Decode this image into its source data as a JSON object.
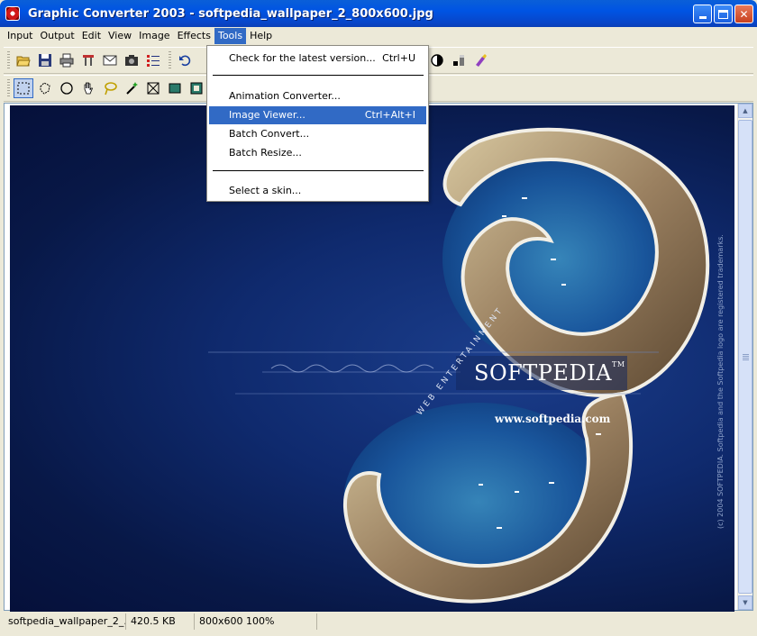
{
  "window": {
    "title": "Graphic Converter 2003 - softpedia_wallpaper_2_800x600.jpg"
  },
  "menubar": {
    "items": [
      {
        "label": "Input"
      },
      {
        "label": "Output"
      },
      {
        "label": "Edit"
      },
      {
        "label": "View"
      },
      {
        "label": "Image"
      },
      {
        "label": "Effects"
      },
      {
        "label": "Tools",
        "active": true
      },
      {
        "label": "Help"
      }
    ]
  },
  "tools_menu": {
    "items": [
      {
        "label": "Check for the latest version...",
        "shortcut": "Ctrl+U"
      },
      {
        "label": "Animation Converter...",
        "shortcut": ""
      },
      {
        "label": "Image Viewer...",
        "shortcut": "Ctrl+Alt+I",
        "highlighted": true
      },
      {
        "label": "Batch Convert...",
        "shortcut": ""
      },
      {
        "label": "Batch Resize...",
        "shortcut": ""
      },
      {
        "label": "Select a skin...",
        "shortcut": ""
      }
    ]
  },
  "toolbar1": {
    "icons": [
      "open-folder-icon",
      "save-disk-icon",
      "print-icon",
      "scan-icon",
      "envelope-icon",
      "camera-icon",
      "list-icon",
      "undo-icon"
    ]
  },
  "toolbar2": {
    "icons": [
      "rect-select-icon",
      "lasso-select-icon",
      "ellipse-icon",
      "hand-icon",
      "magic-lasso-icon",
      "magic-wand-icon",
      "crop-icon",
      "fill-rect-icon",
      "frame-icon"
    ]
  },
  "image": {
    "brand": "SOFTPEDIA",
    "trademark": "TM",
    "url": "www.softpedia.com",
    "tagline": "WEB ENTERTAINMENT",
    "copyright": "(c) 2004 SOFTPEDIA. Softpedia and the Softpedia logo are registered trademarks."
  },
  "statusbar": {
    "filename": "softpedia_wallpaper_2_...",
    "filesize": "420.5 KB",
    "dimensions": "800x600 100%"
  },
  "colors": {
    "titlebar": "#0054e3",
    "menu_highlight": "#316ac5",
    "chrome": "#ece9d8"
  }
}
